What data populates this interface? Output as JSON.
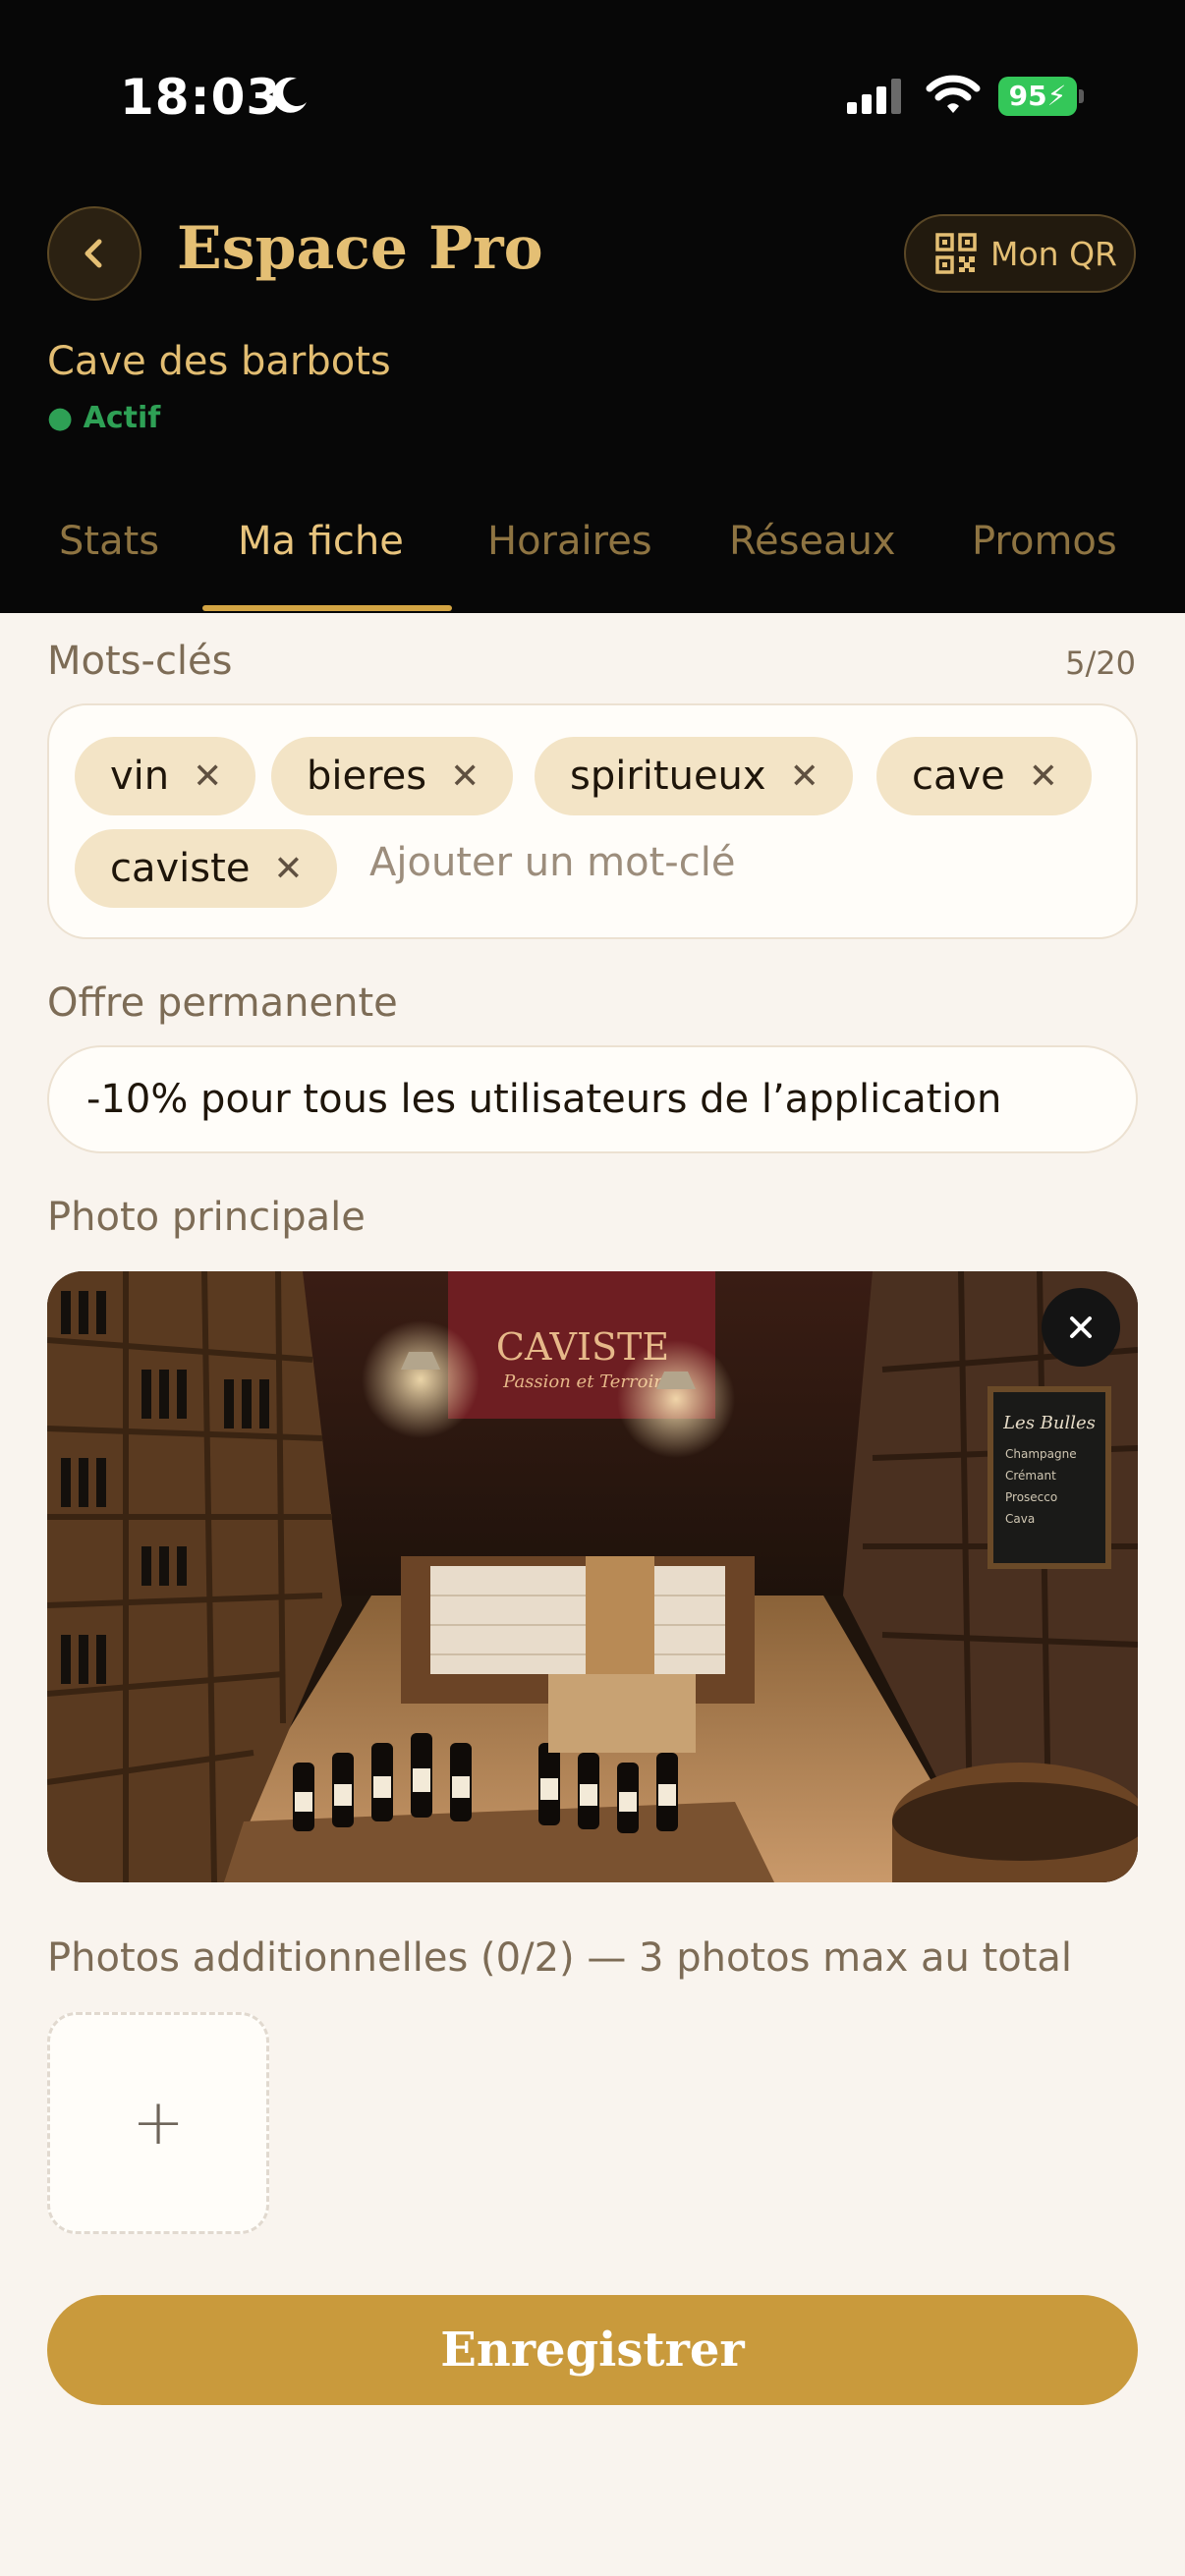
{
  "status_bar": {
    "time": "18:03",
    "battery": "95"
  },
  "header": {
    "title": "Espace Pro",
    "qr_button": "Mon QR",
    "shop_name": "Cave des barbots",
    "status": "● Actif"
  },
  "tabs": [
    {
      "label": "Stats",
      "active": false
    },
    {
      "label": "Ma fiche",
      "active": true
    },
    {
      "label": "Horaires",
      "active": false
    },
    {
      "label": "Réseaux",
      "active": false
    },
    {
      "label": "Promos",
      "active": false
    }
  ],
  "keywords": {
    "label": "Mots-clés",
    "counter": "5/20",
    "chips": [
      "vin",
      "bieres",
      "spiritueux",
      "cave",
      "caviste"
    ],
    "input_placeholder": "Ajouter un mot-clé"
  },
  "offer": {
    "label": "Offre permanente",
    "value": "-10% pour tous les utilisateurs de l’application"
  },
  "main_photo": {
    "label": "Photo principale",
    "sign_title": "CAVISTE",
    "sign_subtitle": "Passion et Terroir",
    "board_title": "Les Bulles",
    "board_items": [
      "Champagne",
      "Crémant",
      "Prosecco",
      "Cava"
    ]
  },
  "additional_photos": {
    "label": "Photos additionnelles (0/2) — 3 photos max au total",
    "add_symbol": "+"
  },
  "save_button": "Enregistrer",
  "colors": {
    "header_bg": "#070707",
    "gold": "#e4bf74",
    "accent_button": "#c99a3c",
    "chip_bg": "#f3e4c6",
    "page_bg": "#f9f4ee",
    "active_green": "#2ea055"
  }
}
